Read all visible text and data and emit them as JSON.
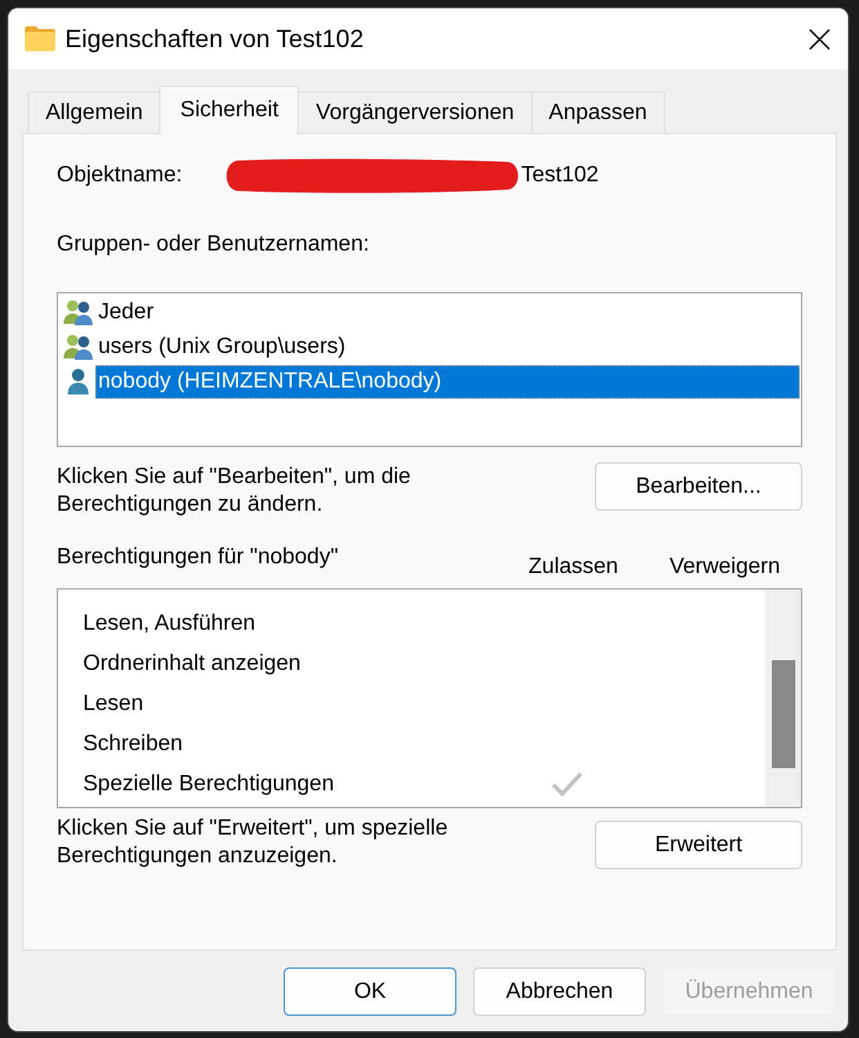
{
  "window": {
    "title": "Eigenschaften von Test102"
  },
  "tabs": [
    {
      "label": "Allgemein",
      "selected": false
    },
    {
      "label": "Sicherheit",
      "selected": true
    },
    {
      "label": "Vorgängerversionen",
      "selected": false
    },
    {
      "label": "Anpassen",
      "selected": false
    }
  ],
  "object_name": {
    "label": "Objektname:",
    "value": "Test102"
  },
  "groups": {
    "label": "Gruppen- oder Benutzernamen:",
    "items": [
      {
        "name": "Jeder",
        "kind": "group",
        "selected": false
      },
      {
        "name": "users (Unix Group\\users)",
        "kind": "group",
        "selected": false
      },
      {
        "name": "nobody (HEIMZENTRALE\\nobody)",
        "kind": "user",
        "selected": true
      }
    ]
  },
  "edit_hint": "Klicken Sie auf \"Bearbeiten\", um die Berechtigungen zu ändern.",
  "edit_button": "Bearbeiten...",
  "permissions": {
    "title": "Berechtigungen für \"nobody\"",
    "columns": [
      "Zulassen",
      "Verweigern"
    ],
    "rows": [
      {
        "name": "Lesen, Ausführen",
        "allow": false,
        "deny": false
      },
      {
        "name": "Ordnerinhalt anzeigen",
        "allow": false,
        "deny": false
      },
      {
        "name": "Lesen",
        "allow": false,
        "deny": false
      },
      {
        "name": "Schreiben",
        "allow": false,
        "deny": false
      },
      {
        "name": "Spezielle Berechtigungen",
        "allow": true,
        "deny": false
      }
    ]
  },
  "advanced_hint": "Klicken Sie auf \"Erweitert\", um spezielle Berechtigungen anzuzeigen.",
  "advanced_button": "Erweitert",
  "buttons": [
    {
      "label": "OK",
      "default": true,
      "disabled": false
    },
    {
      "label": "Abbrechen",
      "default": false,
      "disabled": false
    },
    {
      "label": "Übernehmen",
      "default": false,
      "disabled": true
    }
  ]
}
